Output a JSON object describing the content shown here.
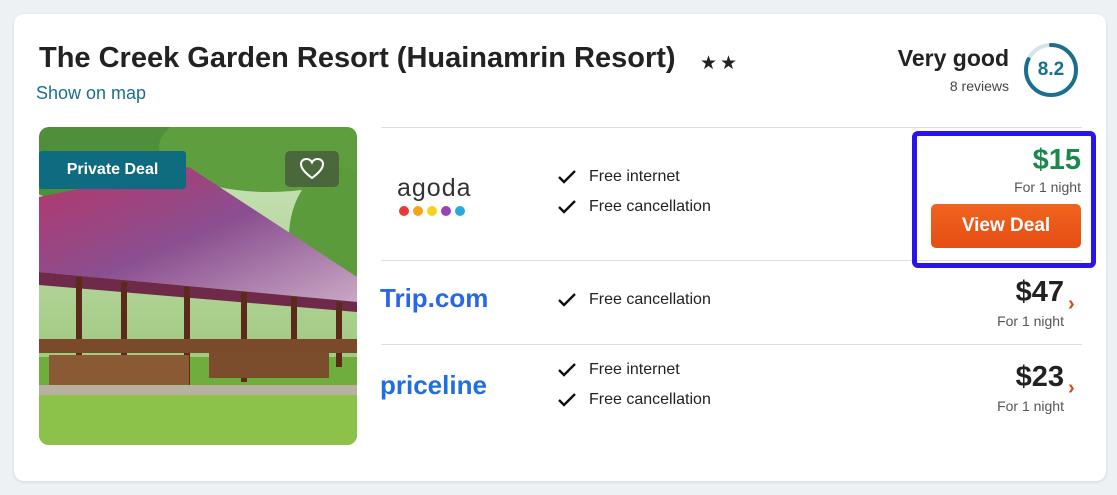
{
  "hotel": {
    "name": "The Creek Garden Resort (Huainamrin Resort)",
    "stars": "★★",
    "map_link": "Show on map"
  },
  "rating": {
    "label": "Very good",
    "reviews": "8 reviews",
    "score": "8.2",
    "score_fraction": 0.82,
    "color": "#1a6f8f"
  },
  "photo": {
    "badge": "Private Deal",
    "favorite_icon": "heart-icon"
  },
  "offers": [
    {
      "provider": "agoda",
      "amenities": [
        "Free internet",
        "Free cancellation"
      ],
      "price": "$15",
      "per_night": "For 1 night",
      "button": "View Deal",
      "price_color": "#1a8a4a"
    },
    {
      "provider": "Trip.com",
      "amenities": [
        "Free cancellation"
      ],
      "price": "$47",
      "per_night": "For 1 night"
    },
    {
      "provider": "priceline",
      "amenities": [
        "Free internet",
        "Free cancellation"
      ],
      "price": "$23",
      "per_night": "For 1 night"
    }
  ],
  "colors": {
    "brand_teal": "#0f6b80",
    "deal_orange": "#e54d14",
    "highlight_blue": "#2b14e8",
    "chevron": "#d9481a"
  }
}
